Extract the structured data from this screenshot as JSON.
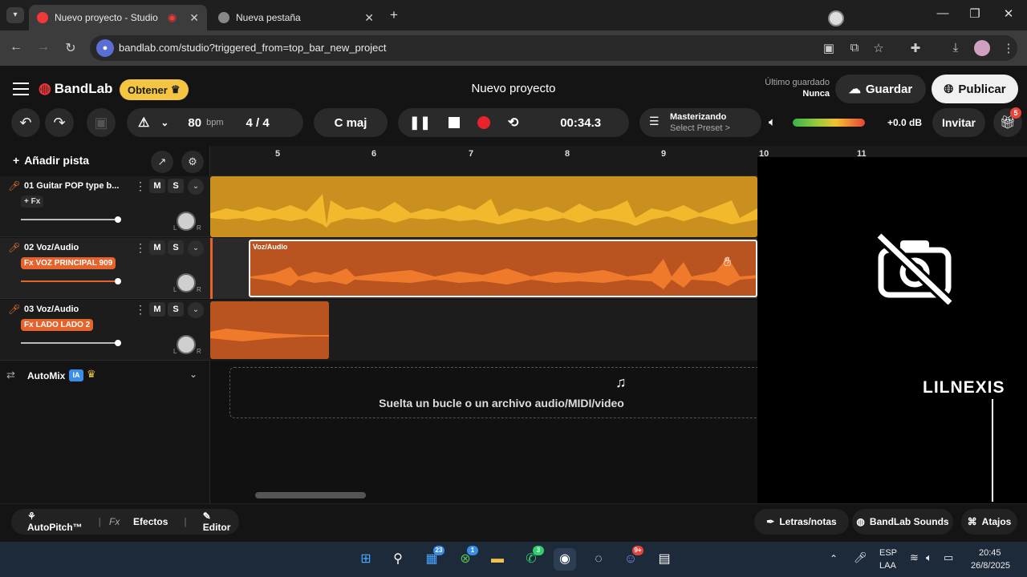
{
  "browser": {
    "tabs": [
      {
        "title": "Nuevo proyecto - Studio",
        "active": true
      },
      {
        "title": "Nueva pestaña",
        "active": false
      }
    ],
    "new_tab": "+",
    "url": "bandlab.com/studio?triggered_from=top_bar_new_project"
  },
  "app": {
    "brand": "BandLab",
    "obtener": "Obtener",
    "project_title": "Nuevo proyecto",
    "last_saved_label": "Último guardado",
    "last_saved_value": "Nunca",
    "save": "Guardar",
    "publish": "Publicar"
  },
  "toolbar": {
    "bpm_value": "80",
    "bpm_unit": "bpm",
    "time_signature": "4 / 4",
    "key": "C maj",
    "time": "00:34.3",
    "master_title": "Masterizando",
    "master_preset": "Select Preset >",
    "gain": "+0.0 dB",
    "invite": "Invitar",
    "gift_badge": "5",
    "meter_level": 0.6
  },
  "tracks": [
    {
      "name": "01  Guitar POP type b...",
      "fx": "+ Fx",
      "fx_style": "plain",
      "volume": 0.9,
      "color": "#f0a92b"
    },
    {
      "name": "02  Voz/Audio",
      "fx": "Fx VOZ PRINCIPAL 909",
      "fx_style": "orange",
      "volume": 0.9,
      "color": "#e8632b"
    },
    {
      "name": "03  Voz/Audio",
      "fx": "Fx LADO LADO 2",
      "fx_style": "orange",
      "volume": 0.9,
      "color": "#e8632b"
    }
  ],
  "track_controls": {
    "mute": "M",
    "solo": "S",
    "pan_left": "L",
    "pan_right": "R"
  },
  "add_track": "Añadir pista",
  "automix": {
    "label": "AutoMix",
    "ia": "IA"
  },
  "ruler": [
    "5",
    "6",
    "7",
    "8",
    "9",
    "10",
    "11"
  ],
  "region_label": "Voz/Audio",
  "dropzone": "Suelta un bucle o un archivo audio/MIDI/video",
  "overlay_tag": "LILNEXIS",
  "bottom": {
    "autopitch": "AutoPitch™",
    "fx_prefix": "Fx",
    "effects": "Efectos",
    "editor": "Editor",
    "lyrics": "Letras/notas",
    "sounds": "BandLab Sounds",
    "shortcuts": "Atajos"
  },
  "taskbar": {
    "lang1": "ESP",
    "lang2": "LAA",
    "time": "20:45",
    "date": "26/8/2025",
    "badges": [
      "23",
      "1",
      "3",
      "9+"
    ]
  },
  "colors": {
    "accent": "#f07a2b",
    "gold": "#f4c542",
    "record": "#e8242a"
  }
}
